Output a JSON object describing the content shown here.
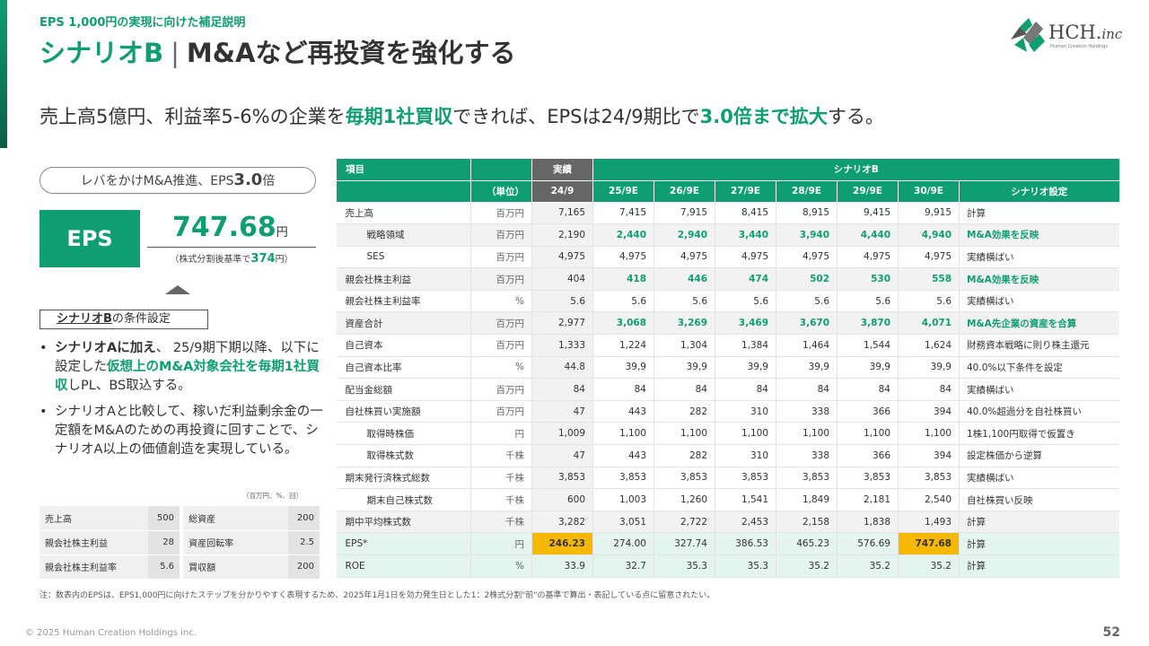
{
  "header": {
    "kicker": "EPS 1,000円の実現に向けた補足説明",
    "title_accent": "シナリオB",
    "title_sep": "|",
    "title_rest": "M&Aなど再投資を強化する",
    "logo_main": "HCH.",
    "logo_inc": "inc",
    "logo_sub": "Human Creation Holdings"
  },
  "headline": {
    "p1": "売上高5億円、利益率5-6%の企業を",
    "p2": "毎期1社買収",
    "p3": "できれば、EPSは24/9期比で",
    "p4": "3.0倍まで拡大",
    "p5": "する。"
  },
  "left": {
    "pill_text": "レバをかけM&A推進、EPS",
    "pill_bold": "3.0",
    "pill_suffix": "倍",
    "eps_label": "EPS",
    "eps_value": "747.68",
    "eps_unit": "円",
    "eps_note_pre": "（株式分割後基準で",
    "eps_note_val": "374",
    "eps_note_post": "円）",
    "cond_bold": "シナリオB",
    "cond_rest": "の条件設定",
    "b1_bold": "シナリオAに加え",
    "b1_a": "、 25/9期下期以降、以下に設定した",
    "b1_g": "仮想上のM&A対象会社を毎期1社買収",
    "b1_b": "しPL、BS取込する。",
    "b2": "シナリオAと比較して、稼いだ利益剰余金の一定額をM&Aのための再投資に回すことで、シナリオA以上の価値創造を実現している。",
    "mini_unit": "（百万円、%、回）",
    "mini_rows": [
      {
        "k1": "売上高",
        "v1": "500",
        "k2": "総資産",
        "v2": "200"
      },
      {
        "k1": "親会社株主利益",
        "v1": "28",
        "k2": "資産回転率",
        "v2": "2.5"
      },
      {
        "k1": "親会社株主利益率",
        "v1": "5.6",
        "k2": "買収額",
        "v2": "200"
      }
    ]
  },
  "table": {
    "h_item": "項目",
    "h_actual": "実績",
    "h_scenario": "シナリオB",
    "h_unit": "（単位）",
    "periods": [
      "24/9",
      "25/9E",
      "26/9E",
      "27/9E",
      "28/9E",
      "29/9E",
      "30/9E"
    ],
    "h_setting": "シナリオ設定",
    "rows": [
      {
        "item": "売上高",
        "unit": "百万円",
        "v": [
          "7,165",
          "7,415",
          "7,915",
          "8,415",
          "8,915",
          "9,415",
          "9,915"
        ],
        "note": "計算"
      },
      {
        "item": "戦略領域",
        "unit": "百万円",
        "v": [
          "2,190",
          "2,440",
          "2,940",
          "3,440",
          "3,940",
          "4,440",
          "4,940"
        ],
        "note": "M&A効果を反映"
      },
      {
        "item": "SES",
        "unit": "百万円",
        "v": [
          "4,975",
          "4,975",
          "4,975",
          "4,975",
          "4,975",
          "4,975",
          "4,975"
        ],
        "note": "実績横ばい"
      },
      {
        "item": "親会社株主利益",
        "unit": "百万円",
        "v": [
          "404",
          "418",
          "446",
          "474",
          "502",
          "530",
          "558"
        ],
        "note": "M&A効果を反映"
      },
      {
        "item": "親会社株主利益率",
        "unit": "%",
        "v": [
          "5.6",
          "5.6",
          "5.6",
          "5.6",
          "5.6",
          "5.6",
          "5.6"
        ],
        "note": "実績横ばい"
      },
      {
        "item": "資産合計",
        "unit": "百万円",
        "v": [
          "2,977",
          "3,068",
          "3,269",
          "3,469",
          "3,670",
          "3,870",
          "4,071"
        ],
        "note": "M&A先企業の資産を合算"
      },
      {
        "item": "自己資本",
        "unit": "百万円",
        "v": [
          "1,333",
          "1,224",
          "1,304",
          "1,384",
          "1,464",
          "1,544",
          "1,624"
        ],
        "note": "財務資本戦略に則り株主還元"
      },
      {
        "item": "自己資本比率",
        "unit": "%",
        "v": [
          "44.8",
          "39,9",
          "39,9",
          "39,9",
          "39,9",
          "39,9",
          "39,9"
        ],
        "note": "40.0%以下条件を設定"
      },
      {
        "item": "配当金総額",
        "unit": "百万円",
        "v": [
          "84",
          "84",
          "84",
          "84",
          "84",
          "84",
          "84"
        ],
        "note": "実績横ばい"
      },
      {
        "item": "自社株買い実施額",
        "unit": "百万円",
        "v": [
          "47",
          "443",
          "282",
          "310",
          "338",
          "366",
          "394"
        ],
        "note": "40.0%超過分を自社株買い"
      },
      {
        "item": "取得時株価",
        "unit": "円",
        "v": [
          "1,009",
          "1,100",
          "1,100",
          "1,100",
          "1,100",
          "1,100",
          "1,100"
        ],
        "note": "1株1,100円取得で仮置き"
      },
      {
        "item": "取得株式数",
        "unit": "千株",
        "v": [
          "47",
          "443",
          "282",
          "310",
          "338",
          "366",
          "394"
        ],
        "note": "設定株価から逆算"
      },
      {
        "item": "期末発行済株式総数",
        "unit": "千株",
        "v": [
          "3,853",
          "3,853",
          "3,853",
          "3,853",
          "3,853",
          "3,853",
          "3,853"
        ],
        "note": "実績横ばい"
      },
      {
        "item": "期末自己株式数",
        "unit": "千株",
        "v": [
          "600",
          "1,003",
          "1,260",
          "1,541",
          "1,849",
          "2,181",
          "2,540"
        ],
        "note": "自社株買い反映"
      },
      {
        "item": "期中平均株式数",
        "unit": "千株",
        "v": [
          "3,282",
          "3,051",
          "2,722",
          "2,453",
          "2,158",
          "1,838",
          "1,493"
        ],
        "note": "計算"
      },
      {
        "item": "EPS*",
        "unit": "円",
        "v": [
          "246.23",
          "274.00",
          "327.74",
          "386.53",
          "465.23",
          "576.69",
          "747.68"
        ],
        "note": "計算"
      },
      {
        "item": "ROE",
        "unit": "%",
        "v": [
          "33.9",
          "32.7",
          "35.3",
          "35.3",
          "35.2",
          "35.2",
          "35.2"
        ],
        "note": "計算"
      }
    ]
  },
  "footnote": "注：数表内のEPSは、EPS1,000円に向けたステップを分かりやすく表現するため、2025年1月1日を効力発生日とした1：2株式分割\"前\"の基準で算出・表記している点に留意されたい。",
  "copyright": "© 2025 Human Creation Holdings inc.",
  "page_number": "52",
  "colors": {
    "accent": "#0e9e72",
    "highlight": "#f6b800",
    "eps_row": "#e4f4ee"
  }
}
